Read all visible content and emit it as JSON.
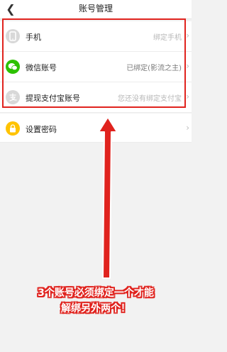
{
  "header": {
    "title": "账号管理",
    "back_icon": "chevron-left-icon"
  },
  "accounts": [
    {
      "label": "手机",
      "value": "绑定手机",
      "icon": "phone-icon",
      "value_style": "light"
    },
    {
      "label": "微信账号",
      "value": "已绑定(影流之主)",
      "icon": "wechat-icon",
      "value_style": "normal"
    },
    {
      "label": "提现支付宝账号",
      "value": "您还没有绑定支付宝",
      "icon": "alipay-icon",
      "value_style": "light"
    }
  ],
  "password": {
    "label": "设置密码",
    "icon": "lock-icon"
  },
  "annotation": {
    "line1": "3个账号必须绑定一个才能",
    "line2": "解绑另外两个！"
  },
  "colors": {
    "highlight": "#e0231e",
    "wechat": "#2dc100",
    "lock": "#ffc300"
  }
}
